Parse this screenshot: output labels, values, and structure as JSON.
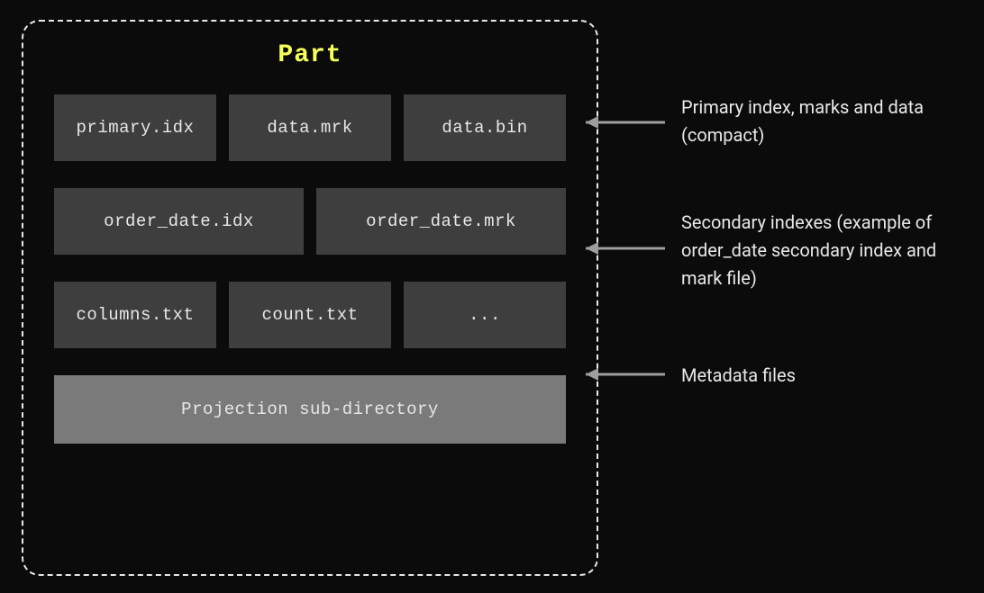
{
  "part": {
    "title": "Part",
    "row1": [
      "primary.idx",
      "data.mrk",
      "data.bin"
    ],
    "row2": [
      "order_date.idx",
      "order_date.mrk"
    ],
    "row3": [
      "columns.txt",
      "count.txt",
      "..."
    ],
    "projection": "Projection sub-directory"
  },
  "annotations": {
    "a1": "Primary index, marks and data (compact)",
    "a2": "Secondary indexes (example of order_date secondary index and mark file)",
    "a3": "Metadata files"
  }
}
